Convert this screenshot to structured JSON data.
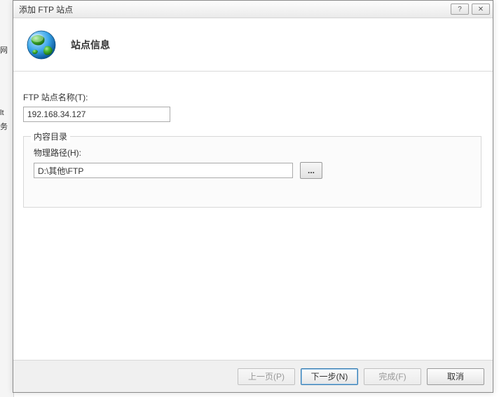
{
  "bg": {
    "t1": "网",
    "t2": "lt",
    "t3": "务"
  },
  "titlebar": {
    "title": "添加 FTP 站点",
    "help": "?",
    "close": "✕"
  },
  "header": {
    "title": "站点信息"
  },
  "form": {
    "site_name_label": "FTP 站点名称(T):",
    "site_name_value": "192.168.34.127",
    "content_dir_legend": "内容目录",
    "physical_path_label": "物理路径(H):",
    "physical_path_value": "D:\\其他\\FTP",
    "browse_label": "..."
  },
  "footer": {
    "prev": "上一页(P)",
    "next": "下一步(N)",
    "finish": "完成(F)",
    "cancel": "取消"
  }
}
